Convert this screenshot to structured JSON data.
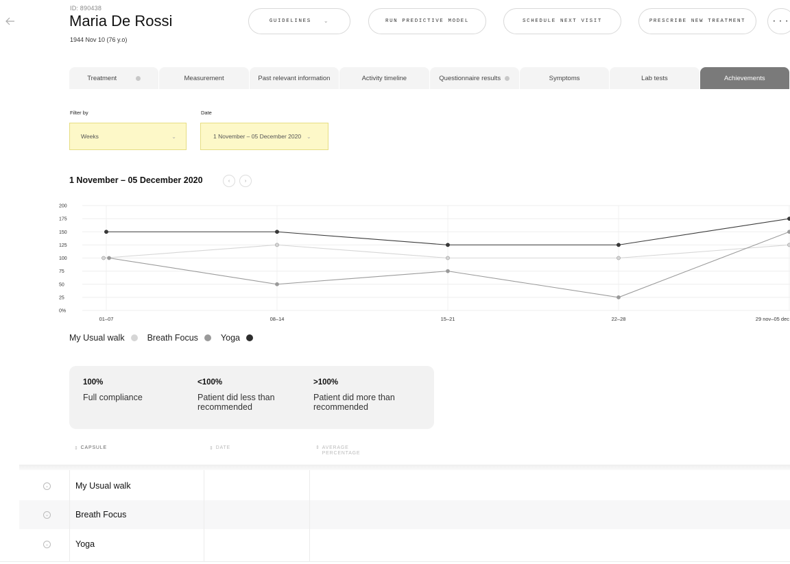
{
  "patient": {
    "id_label": "ID: 890438",
    "name": "Maria De Rossi",
    "dob": "1944 Nov 10 (76 y.o)"
  },
  "actions": {
    "guidelines": "GUIDELINES",
    "run_model": "RUN PREDICTIVE MODEL",
    "schedule": "SCHEDULE NEXT VISIT",
    "prescribe": "PRESCRIBE NEW TREATMENT",
    "more": "···"
  },
  "tabs": [
    {
      "label": "Treatment",
      "dot": true
    },
    {
      "label": "Measurement",
      "dot": false
    },
    {
      "label": "Past relevant information",
      "dot": false
    },
    {
      "label": "Activity timeline",
      "dot": false
    },
    {
      "label": "Questionnaire results",
      "dot": true
    },
    {
      "label": "Symptoms",
      "dot": false
    },
    {
      "label": "Lab tests",
      "dot": false
    },
    {
      "label": "Achievements",
      "dot": false,
      "active": true
    }
  ],
  "filters": {
    "filter_by_label": "Filter by",
    "filter_by_value": "Weeks",
    "date_label": "Date",
    "date_value": "1 November – 05 December 2020"
  },
  "range_title": "1 November – 05 December 2020",
  "chart_data": {
    "type": "line",
    "categories": [
      "01–07",
      "08–14",
      "15–21",
      "22–28",
      "29 nov–05 dec"
    ],
    "y_ticks": [
      "0%",
      "25",
      "50",
      "75",
      "100",
      "125",
      "150",
      "175",
      "200"
    ],
    "ylim": [
      0,
      200
    ],
    "grid": true,
    "legend_position": "bottom-left",
    "series": [
      {
        "name": "My Usual walk",
        "color": "#d6d6d6",
        "values": [
          100,
          125,
          100,
          100,
          125
        ]
      },
      {
        "name": "Breath Focus",
        "color": "#9a9a9a",
        "values": [
          100,
          50,
          75,
          25,
          150
        ]
      },
      {
        "name": "Yoga",
        "color": "#3a3a3a",
        "values": [
          150,
          150,
          125,
          125,
          175
        ]
      }
    ]
  },
  "compliance": [
    {
      "pct": "100%",
      "desc": "Full compliance"
    },
    {
      "pct": "<100%",
      "desc": "Patient did less than recommended"
    },
    {
      "pct": ">100%",
      "desc": "Patient did more than recommended"
    }
  ],
  "table": {
    "headers": {
      "capsule": "CAPSULE",
      "date": "DATE",
      "avg": "AVERAGE PERCENTAGE"
    },
    "rows": [
      {
        "capsule": "My Usual walk"
      },
      {
        "capsule": "Breath Focus"
      },
      {
        "capsule": "Yoga"
      }
    ]
  }
}
